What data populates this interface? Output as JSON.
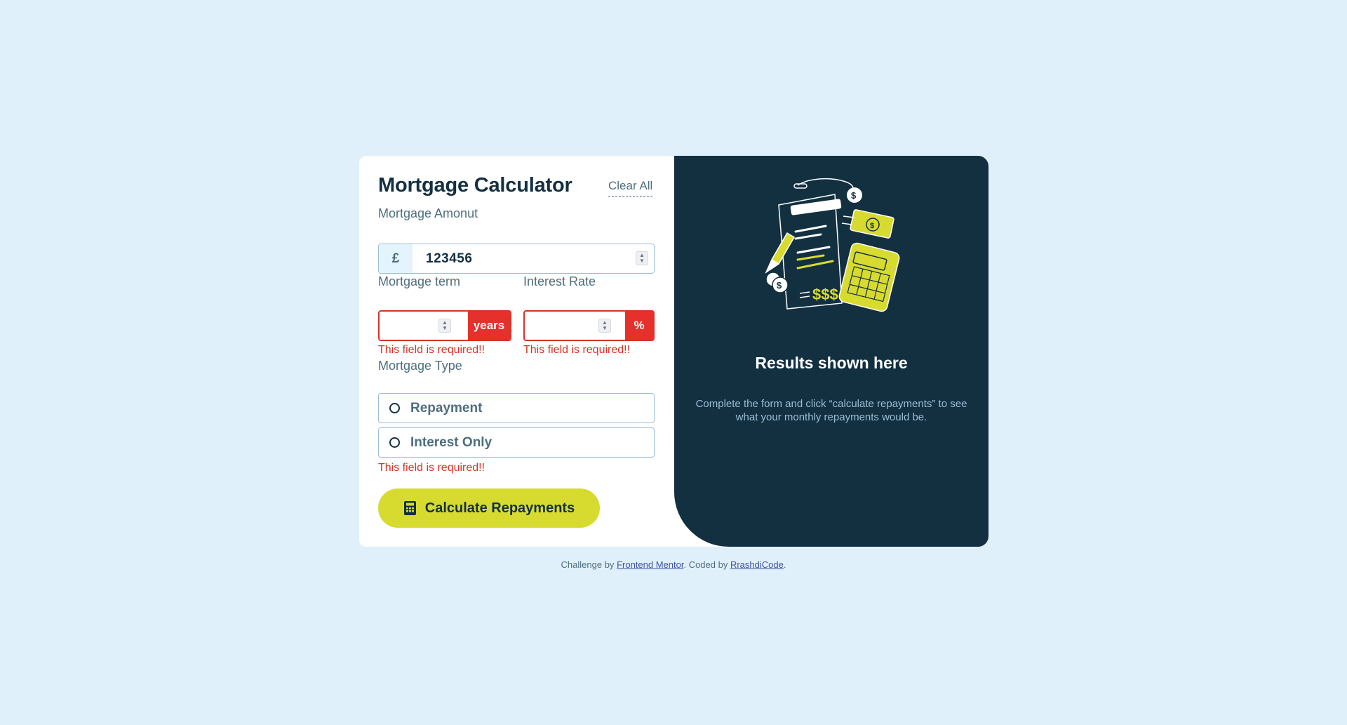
{
  "form": {
    "title": "Mortgage Calculator",
    "clear_all": "Clear All",
    "amount": {
      "label": "Mortgage Amonut",
      "prefix": "£",
      "value": "123456"
    },
    "term": {
      "label": "Mortgage term",
      "value": "",
      "suffix": "years",
      "error": "This field is required!!"
    },
    "rate": {
      "label": "Interest Rate",
      "value": "",
      "suffix": "%",
      "error": "This field is required!!"
    },
    "type": {
      "label": "Mortgage Type",
      "options": [
        "Repayment",
        "Interest Only"
      ],
      "error": "This field is required!!"
    },
    "submit_label": "Calculate Repayments"
  },
  "results": {
    "title": "Results shown here",
    "description": "Complete the form and click “calculate repayments” to see what your monthly repayments would be.",
    "illustration_icon": "empty-results-illustration"
  },
  "footer": {
    "prefix": "Challenge by",
    "link1": "Frontend Mentor",
    "middle": ". Coded by",
    "link2": "RrashdiCode",
    "suffix": "."
  },
  "colors": {
    "background": "#e0f0fb",
    "dark": "#133041",
    "lime": "#d8db2f",
    "error": "#d73328",
    "slate": "#4e6e7e"
  }
}
